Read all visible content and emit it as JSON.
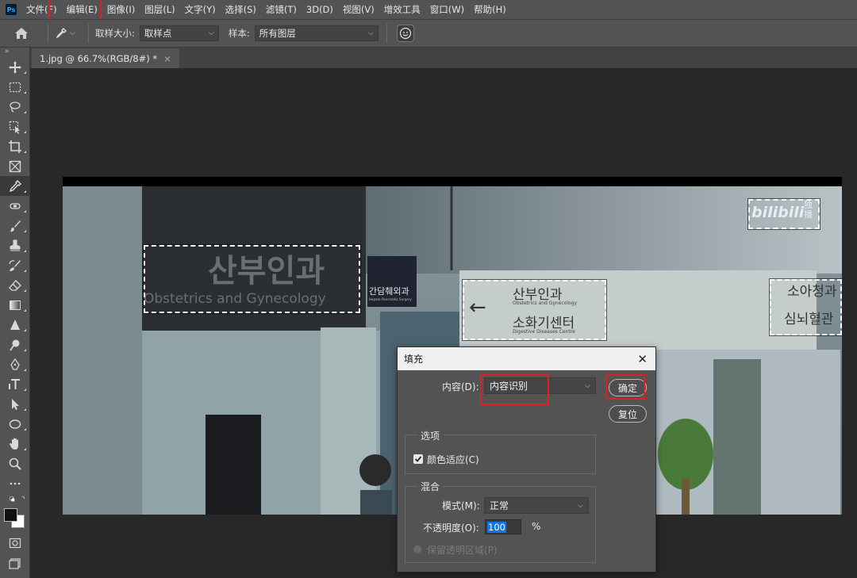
{
  "app": {
    "logo_text": "Ps"
  },
  "menu": {
    "items": [
      "文件(F)",
      "编辑(E)",
      "图像(I)",
      "图层(L)",
      "文字(Y)",
      "选择(S)",
      "滤镜(T)",
      "3D(D)",
      "视图(V)",
      "增效工具",
      "窗口(W)",
      "帮助(H)"
    ]
  },
  "options": {
    "sample_size_label": "取样大小:",
    "sample_size_value": "取样点",
    "sample_label": "样本:",
    "sample_value": "所有图层"
  },
  "document_tab": {
    "title": "1.jpg @ 66.7%(RGB/8#) *",
    "close": "×"
  },
  "image_content": {
    "sign_main_korean": "산부인과",
    "sign_main_english": "Obstetrics and Gynecology",
    "sign_small": "간담췌외과",
    "sign_small_english": "Hepato-Pancreatic Surgery",
    "sign_right_line1": "산부인과",
    "sign_right_line1_en": "Obstetrics and Gynecology",
    "sign_right_line2": "소화기센터",
    "sign_right_line2_en": "Digestive Diseases Centre",
    "sign_far_line1": "소아청과",
    "sign_far_line2": "심뇌혈관",
    "watermark": "bilibili",
    "watermark_side": "独播"
  },
  "dialog": {
    "title": "填充",
    "close": "✕",
    "content_label": "内容(D):",
    "content_value": "内容识别",
    "ok_button": "确定",
    "reset_button": "复位",
    "options_group": "选项",
    "color_adapt_label": "颜色适应(C)",
    "color_adapt_checked": true,
    "blend_group": "混合",
    "mode_label": "模式(M):",
    "mode_value": "正常",
    "opacity_label": "不透明度(O):",
    "opacity_value": "100",
    "opacity_unit": "%",
    "preserve_label": "保留透明区域(P)"
  }
}
